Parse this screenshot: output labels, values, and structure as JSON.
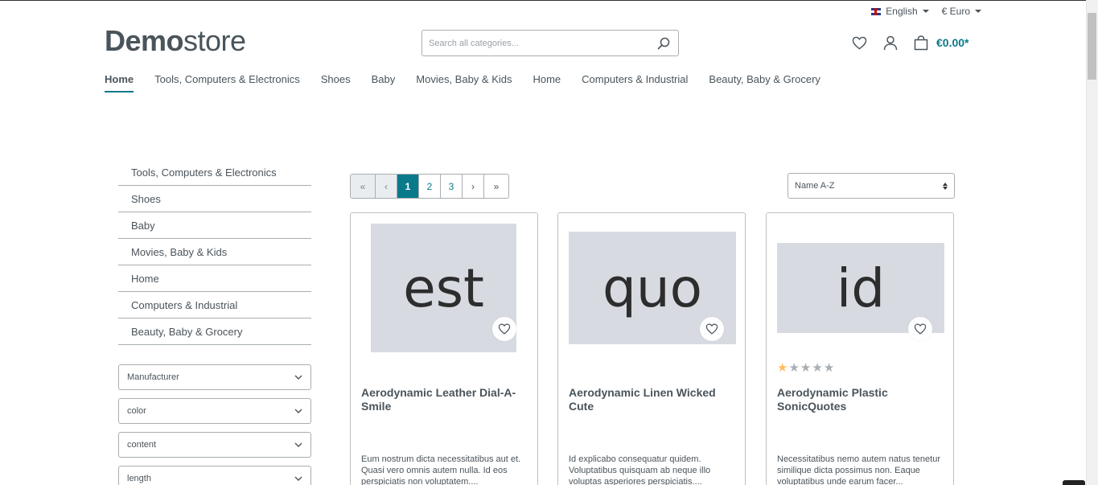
{
  "topbar": {
    "language": "English",
    "currency": "€ Euro"
  },
  "logo": {
    "bold": "Demo",
    "thin": "store"
  },
  "search": {
    "placeholder": "Search all categories..."
  },
  "header": {
    "cart_amount": "€0.00*"
  },
  "nav": [
    "Home",
    "Tools, Computers & Electronics",
    "Shoes",
    "Baby",
    "Movies, Baby & Kids",
    "Home",
    "Computers & Industrial",
    "Beauty, Baby & Grocery"
  ],
  "sidebar": {
    "categories": [
      "Tools, Computers & Electronics",
      "Shoes",
      "Baby",
      "Movies, Baby & Kids",
      "Home",
      "Computers & Industrial",
      "Beauty, Baby & Grocery"
    ],
    "filters": [
      "Manufacturer",
      "color",
      "content",
      "length"
    ]
  },
  "pagination": {
    "first": "«",
    "prev": "‹",
    "pages": [
      "1",
      "2",
      "3"
    ],
    "next": "›",
    "last": "»",
    "current": "1"
  },
  "sort": {
    "selected": "Name A-Z"
  },
  "products": [
    {
      "image_text": "est",
      "name": "Aerodynamic Leather Dial-A-Smile",
      "description": "Eum nostrum dicta necessitatibus aut et. Quasi vero omnis autem nulla. Id eos perspiciatis non voluptatem....",
      "rating": 0
    },
    {
      "image_text": "quo",
      "name": "Aerodynamic Linen Wicked Cute",
      "description": "Id explicabo consequatur quidem. Voluptatibus quisquam ab neque illo voluptas asperiores perspiciatis....",
      "rating": 0
    },
    {
      "image_text": "id",
      "name": "Aerodynamic Plastic SonicQuotes",
      "description": "Necessitatibus nemo autem natus tenetur similique dicta possimus non. Eaque voluptatibus unde earum facer...",
      "rating": 1
    }
  ],
  "colors": {
    "accent": "#0a7a8a",
    "text": "#4a545b",
    "border": "#a8aeb2",
    "placeholder_bg": "#d7dbe1",
    "star": "#ffbd5d"
  }
}
